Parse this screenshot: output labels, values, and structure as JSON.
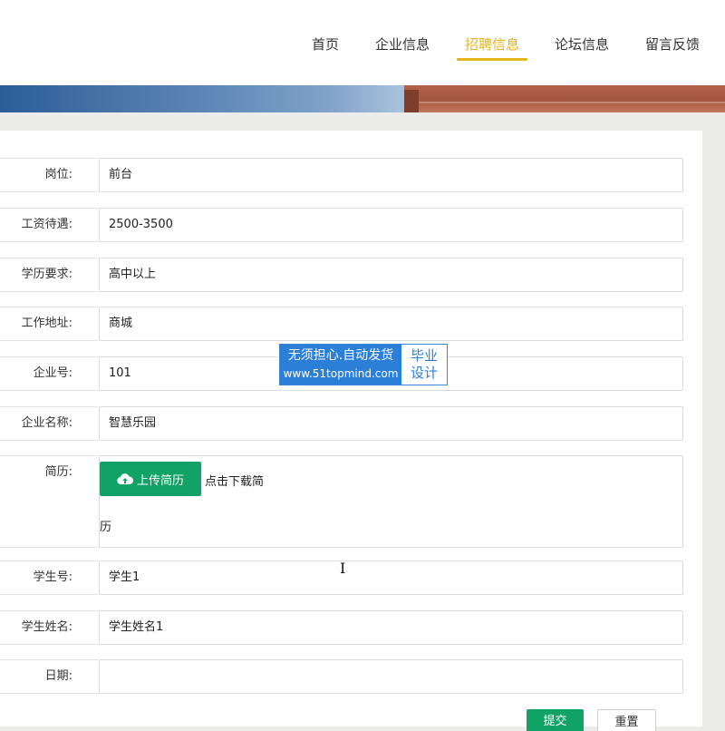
{
  "nav": {
    "items": [
      {
        "label": "首页",
        "active": false
      },
      {
        "label": "企业信息",
        "active": false
      },
      {
        "label": "招聘信息",
        "active": true
      },
      {
        "label": "论坛信息",
        "active": false
      },
      {
        "label": "留言反馈",
        "active": false
      }
    ],
    "accent_color": "#e8b41d"
  },
  "form": {
    "fields": [
      {
        "label": "岗位:",
        "value": "前台"
      },
      {
        "label": "工资待遇:",
        "value": "2500-3500"
      },
      {
        "label": "学历要求:",
        "value": "高中以上"
      },
      {
        "label": "工作地址:",
        "value": "商城"
      },
      {
        "label": "企业号:",
        "value": "101"
      },
      {
        "label": "企业名称:",
        "value": "智慧乐园"
      }
    ],
    "resume": {
      "label": "简历:",
      "upload_label": "上传简历",
      "upload_icon": "cloud-upload-icon",
      "download_text_1": "点击下载简",
      "download_text_2": "历"
    },
    "fields_after": [
      {
        "label": "学生号:",
        "value": "学生1"
      },
      {
        "label": "学生姓名:",
        "value": "学生姓名1"
      },
      {
        "label": "日期:",
        "value": ""
      }
    ],
    "submit_label": "提交",
    "reset_label": "重置",
    "button_color": "#11a265"
  },
  "watermark": {
    "line1": "无须担心.自动发货",
    "line2": "www.51topmind.com",
    "right1": "毕业",
    "right2": "设计"
  }
}
